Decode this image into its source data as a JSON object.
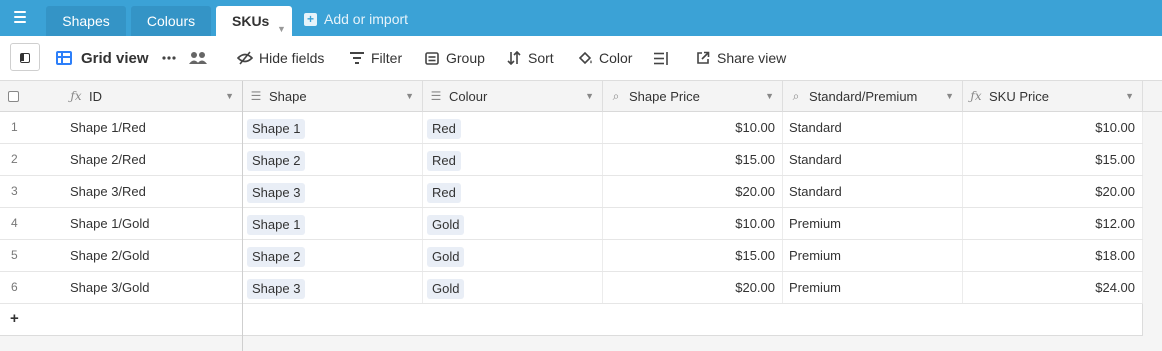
{
  "tabs": [
    {
      "label": "Shapes",
      "active": false
    },
    {
      "label": "Colours",
      "active": false
    },
    {
      "label": "SKUs",
      "active": true
    }
  ],
  "add_import_label": "Add or import",
  "toolbar": {
    "view_name": "Grid view",
    "hide_fields": "Hide fields",
    "filter": "Filter",
    "group": "Group",
    "sort": "Sort",
    "color": "Color",
    "share_view": "Share view"
  },
  "columns": [
    {
      "label": "ID",
      "icon": "formula-icon"
    },
    {
      "label": "Shape",
      "icon": "linked-record-icon"
    },
    {
      "label": "Colour",
      "icon": "linked-record-icon"
    },
    {
      "label": "Shape Price",
      "icon": "lookup-icon"
    },
    {
      "label": "Standard/Premium",
      "icon": "lookup-icon"
    },
    {
      "label": "SKU Price",
      "icon": "formula-icon"
    }
  ],
  "rows": [
    {
      "num": "1",
      "id": "Shape 1/Red",
      "shape": "Shape 1",
      "colour": "Red",
      "shape_price": "$10.00",
      "tier": "Standard",
      "sku_price": "$10.00"
    },
    {
      "num": "2",
      "id": "Shape 2/Red",
      "shape": "Shape 2",
      "colour": "Red",
      "shape_price": "$15.00",
      "tier": "Standard",
      "sku_price": "$15.00"
    },
    {
      "num": "3",
      "id": "Shape 3/Red",
      "shape": "Shape 3",
      "colour": "Red",
      "shape_price": "$20.00",
      "tier": "Standard",
      "sku_price": "$20.00"
    },
    {
      "num": "4",
      "id": "Shape 1/Gold",
      "shape": "Shape 1",
      "colour": "Gold",
      "shape_price": "$10.00",
      "tier": "Premium",
      "sku_price": "$12.00"
    },
    {
      "num": "5",
      "id": "Shape 2/Gold",
      "shape": "Shape 2",
      "colour": "Gold",
      "shape_price": "$15.00",
      "tier": "Premium",
      "sku_price": "$18.00"
    },
    {
      "num": "6",
      "id": "Shape 3/Gold",
      "shape": "Shape 3",
      "colour": "Gold",
      "shape_price": "$20.00",
      "tier": "Premium",
      "sku_price": "$24.00"
    }
  ],
  "add_row_symbol": "+",
  "colors": {
    "accent": "#3ba2d6",
    "brand_blue": "#2d7ff9",
    "chip_bg": "#e9eef6"
  }
}
